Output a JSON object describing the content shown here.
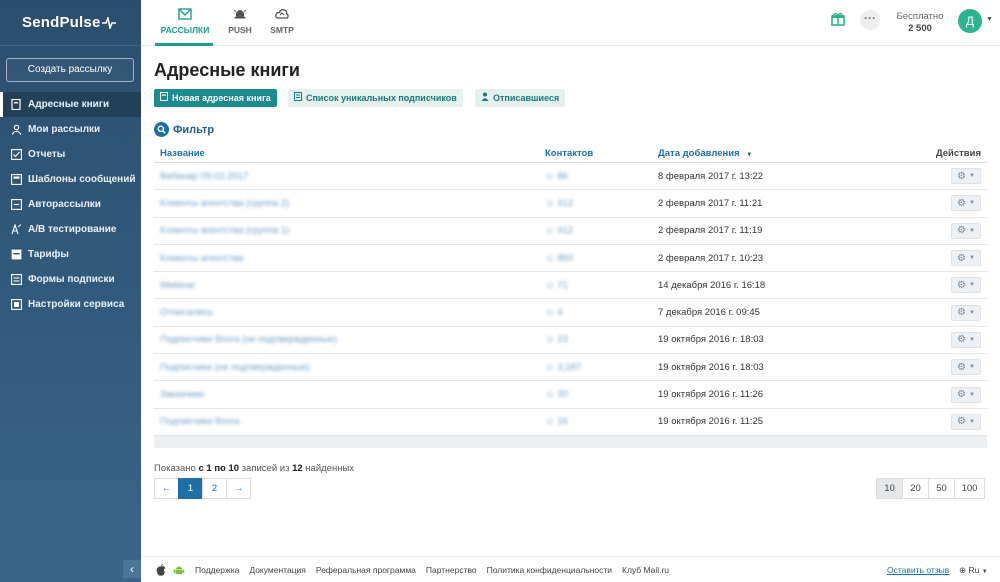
{
  "brand": {
    "logo": "SendPulse"
  },
  "sidebar": {
    "create_label": "Создать рассылку",
    "items": [
      {
        "label": "Адресные книги",
        "icon": "address-book-icon"
      },
      {
        "label": "Мои рассылки",
        "icon": "send-icon"
      },
      {
        "label": "Отчеты",
        "icon": "report-icon"
      },
      {
        "label": "Шаблоны сообщений",
        "icon": "template-icon"
      },
      {
        "label": "Авторассылки",
        "icon": "auto-icon"
      },
      {
        "label": "A/B тестирование",
        "icon": "ab-test-icon"
      },
      {
        "label": "Тарифы",
        "icon": "tariff-icon"
      },
      {
        "label": "Формы подписки",
        "icon": "form-icon"
      },
      {
        "label": "Настройки сервиса",
        "icon": "settings-icon"
      }
    ],
    "collapse": "‹"
  },
  "topbar": {
    "tabs": [
      {
        "label": "РАССЫЛКИ",
        "icon": "mail-icon"
      },
      {
        "label": "PUSH",
        "icon": "bell-icon"
      },
      {
        "label": "SMTP",
        "icon": "cloud-icon"
      }
    ],
    "more": "···",
    "plan_label": "Бесплатно",
    "plan_count": "2 500",
    "avatar_letter": "Д"
  },
  "page": {
    "title": "Адресные книги",
    "buttons": {
      "new_book": "Новая адресная книга",
      "unique": "Список уникальных подписчиков",
      "unsubscribed": "Отписавшиеся"
    },
    "filter_label": "Фильтр"
  },
  "table": {
    "headers": {
      "name": "Название",
      "contacts": "Контактов",
      "date": "Дата добавления",
      "actions": "Действия"
    },
    "sort_indicator": "▼",
    "rows": [
      {
        "name": "Вебинар 09.02.2017",
        "contacts": "86",
        "date": "8 февраля 2017 г. 13:22"
      },
      {
        "name": "Клиенты агентства (группа 2)",
        "contacts": "412",
        "date": "2 февраля 2017 г. 11:21"
      },
      {
        "name": "Клиенты агентства (группа 1)",
        "contacts": "412",
        "date": "2 февраля 2017 г. 11:19"
      },
      {
        "name": "Клиенты агентства",
        "contacts": "850",
        "date": "2 февраля 2017 г. 10:23"
      },
      {
        "name": "Webinar",
        "contacts": "71",
        "date": "14 декабря 2016 г. 16:18"
      },
      {
        "name": "Отписались",
        "contacts": "4",
        "date": "7 декабря 2016 г. 09:45"
      },
      {
        "name": "Подписчики блога (не подтвержденные)",
        "contacts": "23",
        "date": "19 октября 2016 г. 18:03"
      },
      {
        "name": "Подписчики (не подтвержденные)",
        "contacts": "3,187",
        "date": "19 октября 2016 г. 18:03"
      },
      {
        "name": "Заказчики",
        "contacts": "30",
        "date": "19 октября 2016 г. 11:26"
      },
      {
        "name": "Подписчики блога",
        "contacts": "16",
        "date": "19 октября 2016 г. 11:25"
      }
    ]
  },
  "summary": {
    "prefix": "Показано",
    "range": "с 1 по 10",
    "middle": "записей из",
    "total": "12",
    "suffix": "найденных"
  },
  "pager": {
    "prev": "←",
    "pages": [
      "1",
      "2"
    ],
    "next": "→"
  },
  "per_page": [
    "10",
    "20",
    "50",
    "100"
  ],
  "footer": {
    "links": [
      "Поддержка",
      "Документация",
      "Реферальная программа",
      "Партнерство",
      "Политика конфиденциальности",
      "Клуб Mail.ru"
    ],
    "feedback": "Оставить отзыв",
    "lang": "Ru"
  },
  "colors": {
    "accent": "#1c8b8d",
    "sidebar": "#2b4e6e",
    "link": "#1d6fa5",
    "avatar": "#2bb48e"
  }
}
